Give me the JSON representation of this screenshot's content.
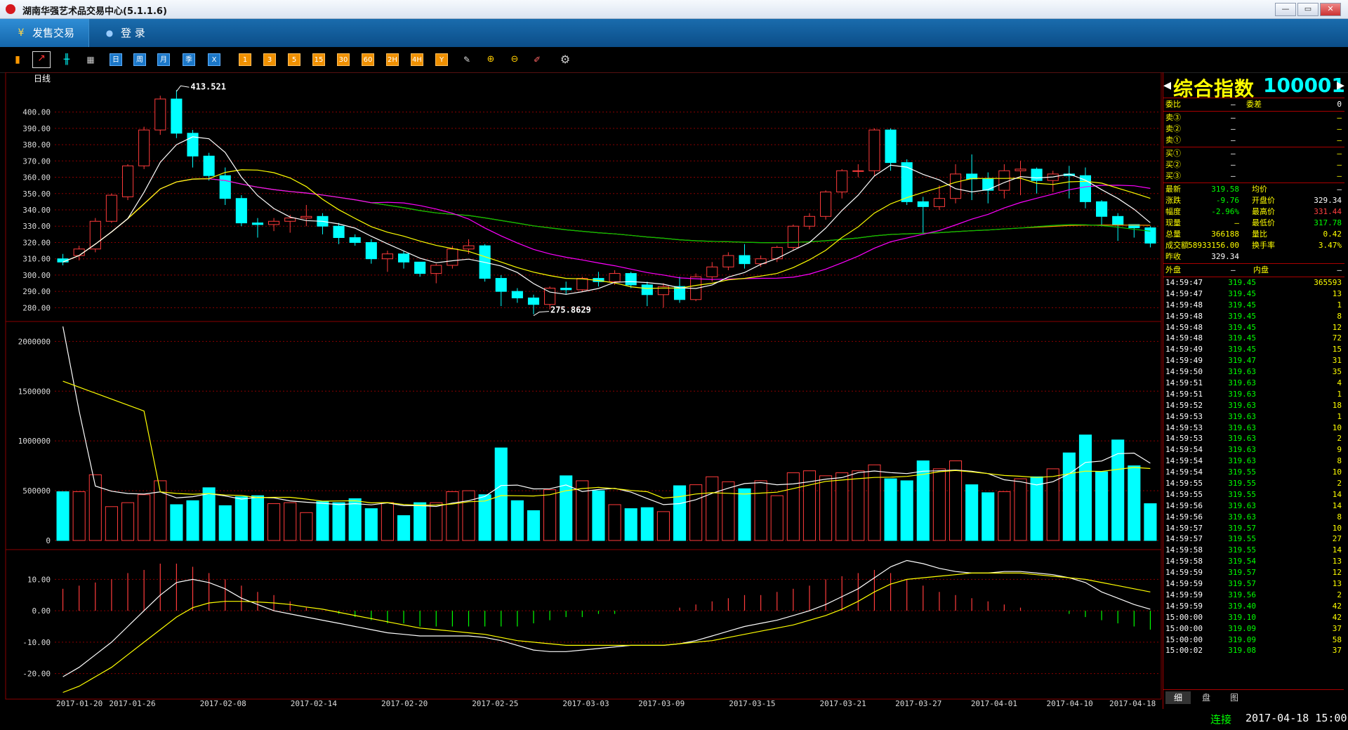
{
  "window": {
    "title": "湖南华强艺术品交易中心(5.1.1.6)",
    "min": "—",
    "max": "▭",
    "close": "✕"
  },
  "menu": {
    "tabs": [
      {
        "label": "发售交易",
        "icon": "¥"
      },
      {
        "label": "登  录",
        "icon": "👤"
      }
    ]
  },
  "toolbar": {
    "left_icons": [
      "bar-chart-icon",
      "line-chart-icon",
      "candlestick-icon",
      "calendar-icon"
    ],
    "period_buttons": [
      "日",
      "周",
      "月",
      "季",
      "X"
    ],
    "minute_buttons": [
      "1",
      "3",
      "5",
      "15",
      "30",
      "60",
      "2H",
      "4H",
      "Y"
    ],
    "tool_icons": [
      "edit-icon",
      "zoom-in-icon",
      "zoom-out-icon",
      "draw-icon",
      "gear-icon"
    ]
  },
  "colors": {
    "up": "#ff3b3b",
    "down": "#00ffff",
    "grid": "#8a0000",
    "ma5": "#ffffff",
    "ma10": "#ffff00",
    "ma20": "#ff00ff",
    "ma60": "#00c000",
    "ma120": "#ff9900"
  },
  "chart_data": {
    "type": "candlestick",
    "period_label": "日线",
    "y_ticks": [
      "400.00",
      "390.00",
      "380.00",
      "370.00",
      "360.00",
      "350.00",
      "340.00",
      "330.00",
      "320.00",
      "310.00",
      "300.00",
      "290.00",
      "280.00"
    ],
    "vol_ticks": [
      "2000000",
      "1500000",
      "1000000",
      "500000",
      "0"
    ],
    "macd_ticks": [
      "10.00",
      "0.00",
      "-10.00",
      "-20.00"
    ],
    "x_labels": [
      "2017-01-20",
      "2017-01-26",
      "2017-02-08",
      "2017-02-14",
      "2017-02-20",
      "2017-02-25",
      "2017-03-03",
      "2017-03-09",
      "2017-03-15",
      "2017-03-21",
      "2017-03-27",
      "2017-04-01",
      "2017-04-10",
      "2017-04-18"
    ],
    "high_label": "413.521",
    "low_label": "275.8629",
    "candles": [
      [
        310,
        308,
        313,
        306
      ],
      [
        312,
        316,
        318,
        309
      ],
      [
        316,
        333,
        335,
        314
      ],
      [
        333,
        349,
        350,
        332
      ],
      [
        348,
        367,
        368,
        346
      ],
      [
        367,
        389,
        391,
        365
      ],
      [
        389,
        408,
        410,
        386
      ],
      [
        408,
        387,
        413.5,
        384
      ],
      [
        387,
        373,
        389,
        366
      ],
      [
        373,
        361,
        375,
        358
      ],
      [
        361,
        347,
        366,
        343
      ],
      [
        347,
        332,
        349,
        330
      ],
      [
        332,
        331,
        335,
        323
      ],
      [
        331,
        333,
        335,
        327
      ],
      [
        333,
        335,
        337,
        326
      ],
      [
        335,
        336,
        343,
        330
      ],
      [
        336,
        330,
        338,
        325
      ],
      [
        330,
        323,
        332,
        319
      ],
      [
        323,
        320,
        325,
        318
      ],
      [
        320,
        310,
        322,
        307
      ],
      [
        310,
        313,
        315,
        302
      ],
      [
        313,
        308,
        315,
        304
      ],
      [
        308,
        301,
        308,
        299
      ],
      [
        301,
        306,
        307,
        295
      ],
      [
        306,
        316,
        318,
        304
      ],
      [
        316,
        318,
        322,
        313
      ],
      [
        318,
        298,
        319,
        296
      ],
      [
        298,
        290,
        300,
        281
      ],
      [
        290,
        286,
        292,
        283
      ],
      [
        286,
        282,
        288,
        276
      ],
      [
        282,
        292,
        293,
        279
      ],
      [
        292,
        291,
        296,
        288
      ],
      [
        291,
        298,
        299,
        290
      ],
      [
        298,
        296,
        302,
        293
      ],
      [
        296,
        301,
        303,
        294
      ],
      [
        301,
        294,
        302,
        292
      ],
      [
        294,
        288,
        296,
        281
      ],
      [
        288,
        293,
        295,
        280
      ],
      [
        293,
        285,
        299,
        283
      ],
      [
        285,
        299,
        301,
        284
      ],
      [
        299,
        305,
        308,
        296
      ],
      [
        305,
        312,
        314,
        303
      ],
      [
        312,
        307,
        319,
        304
      ],
      [
        307,
        310,
        312,
        305
      ],
      [
        310,
        317,
        318,
        308
      ],
      [
        317,
        330,
        331,
        315
      ],
      [
        330,
        336,
        338,
        328
      ],
      [
        336,
        351,
        352,
        334
      ],
      [
        351,
        364,
        365,
        347
      ],
      [
        364,
        364,
        368,
        360
      ],
      [
        364,
        389,
        390,
        361
      ],
      [
        389,
        369,
        390,
        364
      ],
      [
        369,
        345,
        371,
        343
      ],
      [
        345,
        342,
        348,
        326
      ],
      [
        342,
        347,
        355,
        340
      ],
      [
        347,
        362,
        368,
        344
      ],
      [
        362,
        359,
        374,
        346
      ],
      [
        359,
        352,
        363,
        344
      ],
      [
        352,
        364,
        368,
        347
      ],
      [
        364,
        365,
        370,
        349
      ],
      [
        365,
        358,
        366,
        350
      ],
      [
        358,
        362,
        364,
        351
      ],
      [
        362,
        361,
        367,
        347
      ],
      [
        361,
        345,
        366,
        341
      ],
      [
        345,
        336,
        346,
        330
      ],
      [
        336,
        331,
        338,
        321
      ],
      [
        331,
        329,
        331,
        323
      ],
      [
        329,
        319.6,
        330,
        317
      ]
    ],
    "volumes": [
      490000,
      490000,
      660000,
      340000,
      380000,
      460000,
      600000,
      360000,
      400000,
      530000,
      350000,
      440000,
      450000,
      370000,
      380000,
      280000,
      390000,
      380000,
      420000,
      320000,
      380000,
      250000,
      380000,
      380000,
      490000,
      500000,
      460000,
      930000,
      400000,
      300000,
      510000,
      650000,
      600000,
      500000,
      360000,
      320000,
      330000,
      290000,
      550000,
      560000,
      640000,
      590000,
      520000,
      600000,
      450000,
      680000,
      700000,
      650000,
      680000,
      700000,
      760000,
      620000,
      600000,
      800000,
      720000,
      800000,
      560000,
      480000,
      490000,
      620000,
      640000,
      720000,
      880000,
      1060000,
      690000,
      1010000,
      750000,
      370000
    ],
    "macd_hist": [
      7,
      8,
      9,
      10,
      12,
      13,
      15,
      15,
      14,
      12,
      10,
      8,
      6,
      5,
      3,
      1,
      0,
      -1,
      -2,
      -3,
      -4,
      -4,
      -5,
      -5,
      -5,
      -5,
      -5,
      -5,
      -5,
      -4,
      -3,
      -2,
      -2,
      -1,
      -1,
      0,
      0,
      0,
      1,
      2,
      3,
      4,
      5,
      5,
      6,
      7,
      8,
      10,
      11,
      12,
      13,
      12,
      10,
      8,
      6,
      5,
      4,
      3,
      2,
      1,
      0,
      0,
      -1,
      -2,
      -3,
      -4,
      -5,
      -6
    ],
    "macd_dif": [
      -21,
      -18,
      -14,
      -10,
      -5,
      0,
      5,
      9,
      10,
      9,
      7,
      4,
      2,
      0,
      -1,
      -2,
      -3,
      -4,
      -5,
      -6,
      -7,
      -7.5,
      -8,
      -8,
      -8,
      -8,
      -8.5,
      -9.5,
      -11,
      -12.5,
      -13,
      -13,
      -12.5,
      -12,
      -11.5,
      -11,
      -11,
      -11,
      -10.5,
      -9.5,
      -8,
      -6.5,
      -5,
      -4,
      -3,
      -1.5,
      0,
      2,
      4.5,
      7,
      10.5,
      14,
      16,
      15,
      13.5,
      12.5,
      12,
      12,
      12.5,
      12.5,
      12,
      11.5,
      10.5,
      9,
      6,
      4,
      2,
      0.5
    ],
    "macd_dea": [
      -26,
      -24,
      -21,
      -18,
      -14,
      -10,
      -6,
      -2,
      1,
      2.5,
      3,
      3,
      2.8,
      2.5,
      2,
      1.2,
      0.5,
      -0.5,
      -1.5,
      -2.5,
      -3.5,
      -4.5,
      -5.5,
      -6,
      -6.5,
      -7,
      -7.5,
      -8.5,
      -9.5,
      -10,
      -10.5,
      -11,
      -11,
      -11,
      -11,
      -11,
      -11,
      -11,
      -10.5,
      -10,
      -9.5,
      -8.5,
      -7.5,
      -6.5,
      -5.5,
      -4.5,
      -3,
      -1.5,
      0.5,
      3,
      6,
      8.5,
      10,
      10.5,
      11,
      11.5,
      12,
      12,
      12,
      12,
      11.5,
      11,
      10.5,
      10,
      9,
      8,
      7,
      6
    ]
  },
  "quote": {
    "name": "综合指数",
    "code": "100001",
    "wei": [
      {
        "k": "委比",
        "v": "—",
        "k2": "委差",
        "v2": "0"
      }
    ],
    "sell": [
      {
        "k": "卖③",
        "a": "—",
        "b": "—"
      },
      {
        "k": "卖②",
        "a": "—",
        "b": "—"
      },
      {
        "k": "卖①",
        "a": "—",
        "b": "—"
      }
    ],
    "buy": [
      {
        "k": "买①",
        "a": "—",
        "b": "—"
      },
      {
        "k": "买②",
        "a": "—",
        "b": "—"
      },
      {
        "k": "买③",
        "a": "—",
        "b": "—"
      }
    ],
    "stats": [
      {
        "k": "最新",
        "v": "319.58",
        "vc": "#0f0",
        "k2": "均价",
        "v2": "—",
        "v2c": "#fff"
      },
      {
        "k": "涨跌",
        "v": "-9.76",
        "vc": "#0f0",
        "k2": "开盘价",
        "v2": "329.34",
        "v2c": "#fff"
      },
      {
        "k": "幅度",
        "v": "-2.96%",
        "vc": "#0f0",
        "k2": "最高价",
        "v2": "331.44",
        "v2c": "#ff4040"
      },
      {
        "k": "现量",
        "v": "—",
        "vc": "#ff0",
        "k2": "最低价",
        "v2": "317.78",
        "v2c": "#0f0"
      },
      {
        "k": "总量",
        "v": "366188",
        "vc": "#ff0",
        "k2": "量比",
        "v2": "0.42",
        "v2c": "#ff0"
      },
      {
        "k": "成交额",
        "v": "58933156.00",
        "vc": "#ff0",
        "k2": "换手率",
        "v2": "3.47%",
        "v2c": "#ff0"
      },
      {
        "k": "昨收",
        "v": "329.34",
        "vc": "#fff",
        "k2": "",
        "v2": "",
        "v2c": "#fff"
      }
    ],
    "outer_label": "外盘",
    "outer_val": "—",
    "inner_label": "内盘",
    "inner_val": "—",
    "ticks": [
      [
        "14:59:47",
        "319.45",
        "365593"
      ],
      [
        "14:59:47",
        "319.45",
        "13"
      ],
      [
        "14:59:48",
        "319.45",
        "1"
      ],
      [
        "14:59:48",
        "319.45",
        "8"
      ],
      [
        "14:59:48",
        "319.45",
        "12"
      ],
      [
        "14:59:48",
        "319.45",
        "72"
      ],
      [
        "14:59:49",
        "319.45",
        "15"
      ],
      [
        "14:59:49",
        "319.47",
        "31"
      ],
      [
        "14:59:50",
        "319.63",
        "35"
      ],
      [
        "14:59:51",
        "319.63",
        "4"
      ],
      [
        "14:59:51",
        "319.63",
        "1"
      ],
      [
        "14:59:52",
        "319.63",
        "18"
      ],
      [
        "14:59:53",
        "319.63",
        "1"
      ],
      [
        "14:59:53",
        "319.63",
        "10"
      ],
      [
        "14:59:53",
        "319.63",
        "2"
      ],
      [
        "14:59:54",
        "319.63",
        "9"
      ],
      [
        "14:59:54",
        "319.63",
        "8"
      ],
      [
        "14:59:54",
        "319.55",
        "10"
      ],
      [
        "14:59:55",
        "319.55",
        "2"
      ],
      [
        "14:59:55",
        "319.55",
        "14"
      ],
      [
        "14:59:56",
        "319.63",
        "14"
      ],
      [
        "14:59:56",
        "319.63",
        "8"
      ],
      [
        "14:59:57",
        "319.57",
        "10"
      ],
      [
        "14:59:57",
        "319.55",
        "27"
      ],
      [
        "14:59:58",
        "319.55",
        "14"
      ],
      [
        "14:59:58",
        "319.54",
        "13"
      ],
      [
        "14:59:59",
        "319.57",
        "12"
      ],
      [
        "14:59:59",
        "319.57",
        "13"
      ],
      [
        "14:59:59",
        "319.56",
        "2"
      ],
      [
        "14:59:59",
        "319.40",
        "42"
      ],
      [
        "15:00:00",
        "319.10",
        "42"
      ],
      [
        "15:00:00",
        "319.09",
        "37"
      ],
      [
        "15:00:00",
        "319.09",
        "58"
      ],
      [
        "15:00:02",
        "319.08",
        "37"
      ]
    ],
    "bottom_tabs": [
      "细",
      "盘",
      "图"
    ]
  },
  "status": {
    "connection": "连接",
    "datetime": "2017-04-18 15:00"
  }
}
